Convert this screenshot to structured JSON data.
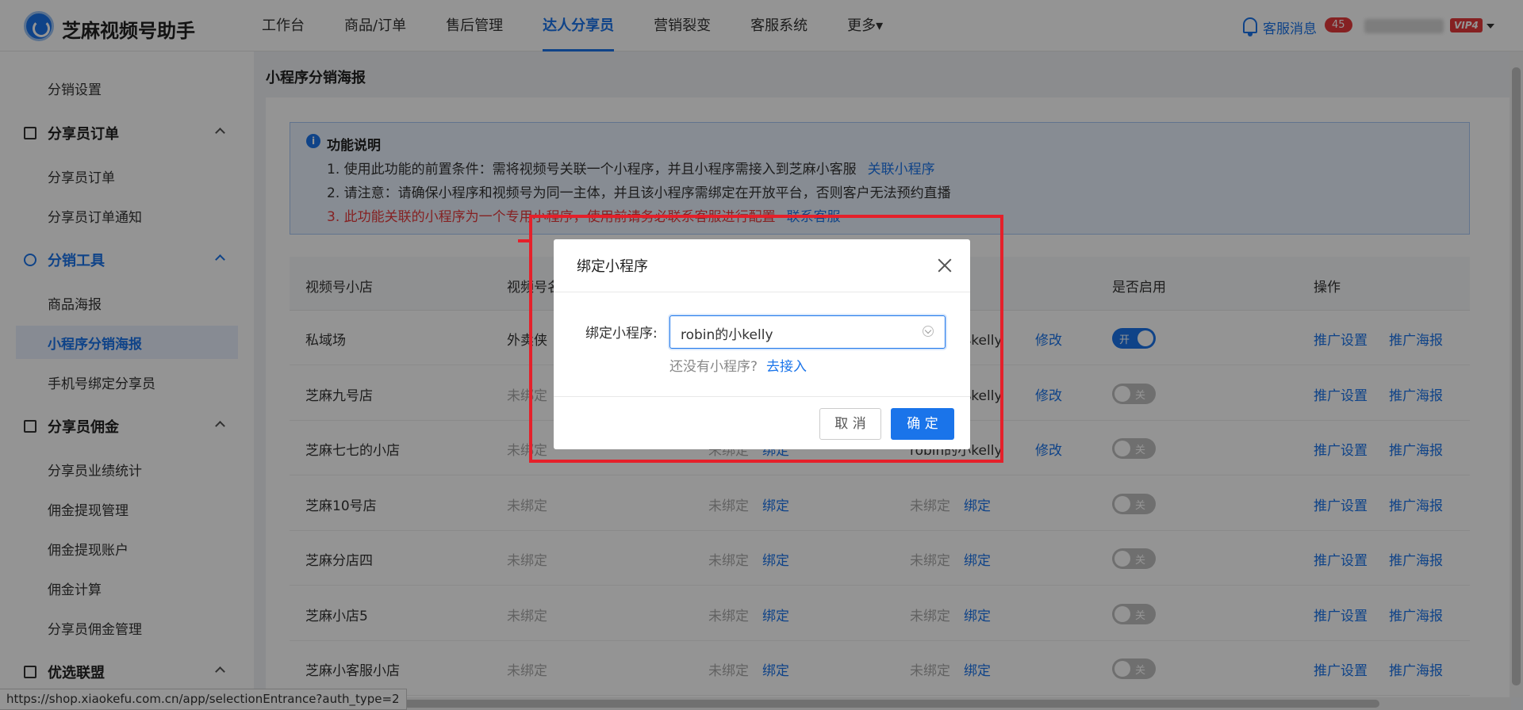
{
  "header": {
    "brand": "芝麻视频号助手",
    "nav": [
      "工作台",
      "商品/订单",
      "售后管理",
      "达人分享员",
      "营销裂变",
      "客服系统",
      "更多▾"
    ],
    "messages_label": "客服消息",
    "messages_count": "45",
    "vip_label": "VIP4"
  },
  "sidebar": {
    "items": {
      "fenxiao_settings": "分销设置",
      "group_orders": "分享员订单",
      "orders": "分享员订单",
      "order_notice": "分享员订单通知",
      "group_tools": "分销工具",
      "product_poster": "商品海报",
      "mini_poster": "小程序分销海报",
      "phone_bind": "手机号绑定分享员",
      "group_commission": "分享员佣金",
      "perf_stats": "分享员业绩统计",
      "withdraw_mgmt": "佣金提现管理",
      "withdraw_account": "佣金提现账户",
      "commission_calc": "佣金计算",
      "commission_mgmt": "分享员佣金管理",
      "group_alliance": "优选联盟"
    }
  },
  "page": {
    "title": "小程序分销海报"
  },
  "notice": {
    "icon": "i",
    "title": "功能说明",
    "line1": "1. 使用此功能的前置条件：需将视频号关联一个小程序，并且小程序需接入到芝麻小客服",
    "line1_link": "关联小程序",
    "line2": "2. 请注意：请确保小程序和视频号为同一主体，并且该小程序需绑定在开放平台，否则客户无法预约直播",
    "line3": "3. 此功能关联的小程序为一个专用小程序，使用前请务必联系客服进行配置",
    "line3_link": "联系客服"
  },
  "table": {
    "headers": {
      "shop": "视频号小店",
      "channel": "视频号名",
      "enable": "是否启用",
      "ops": "操作"
    },
    "rows": [
      {
        "shop": "私域场",
        "channel": "外卖侠",
        "col3": "",
        "col3_link": "",
        "col4": "robin的小kelly",
        "col4_link": "修改",
        "toggle": "开",
        "on": true
      },
      {
        "shop": "芝麻九号店",
        "channel": "未绑定",
        "col3": "",
        "col3_link": "",
        "col4": "robin的小kelly",
        "col4_link": "修改",
        "toggle": "关",
        "on": false
      },
      {
        "shop": "芝麻七七的小店",
        "channel": "未绑定",
        "col3": "未绑定",
        "col3_link": "绑定",
        "col4": "robin的小kelly",
        "col4_link": "修改",
        "toggle": "关",
        "on": false
      },
      {
        "shop": "芝麻10号店",
        "channel": "未绑定",
        "col3": "未绑定",
        "col3_link": "绑定",
        "col4": "未绑定",
        "col4_link": "绑定",
        "toggle": "关",
        "on": false
      },
      {
        "shop": "芝麻分店四",
        "channel": "未绑定",
        "col3": "未绑定",
        "col3_link": "绑定",
        "col4": "未绑定",
        "col4_link": "绑定",
        "toggle": "关",
        "on": false
      },
      {
        "shop": "芝麻小店5",
        "channel": "未绑定",
        "col3": "未绑定",
        "col3_link": "绑定",
        "col4": "未绑定",
        "col4_link": "绑定",
        "toggle": "关",
        "on": false
      },
      {
        "shop": "芝麻小客服小店",
        "channel": "未绑定",
        "col3": "未绑定",
        "col3_link": "绑定",
        "col4": "未绑定",
        "col4_link": "绑定",
        "toggle": "关",
        "on": false
      }
    ],
    "op_settings": "推广设置",
    "op_poster": "推广海报"
  },
  "dialog": {
    "title": "绑定小程序",
    "label": "绑定小程序:",
    "selected": "robin的小kelly",
    "hint": "还没有小程序?",
    "hint_link": "去接入",
    "cancel": "取 消",
    "ok": "确 定"
  },
  "status_url": "https://shop.xiaokefu.com.cn/app/selectionEntrance?auth_type=2",
  "colors": {
    "accent": "#1a74ea",
    "danger": "#e6393b",
    "annotation": "#e5202a"
  }
}
